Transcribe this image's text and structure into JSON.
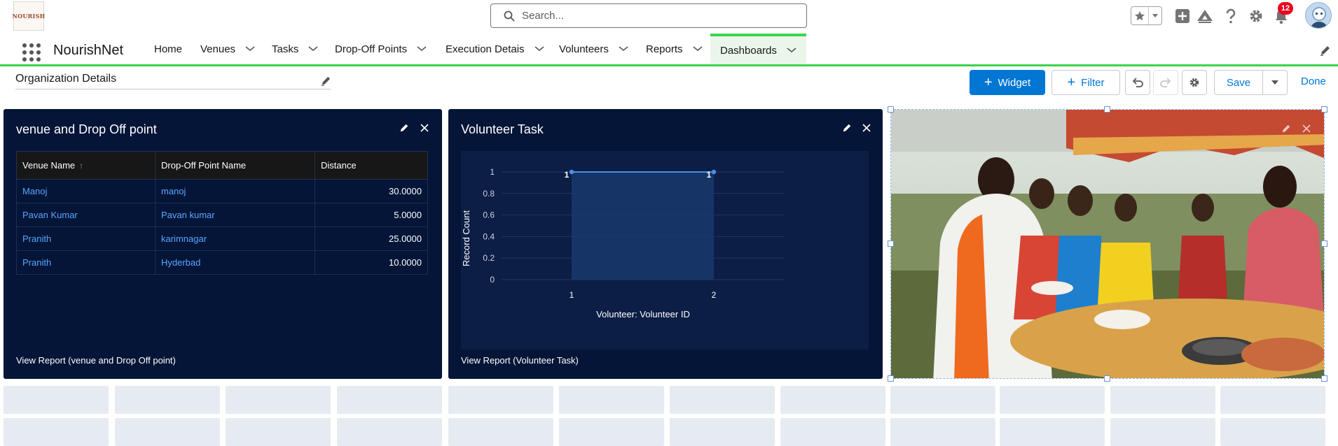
{
  "header": {
    "logo_text": "NOURISH",
    "search_placeholder": "Search...",
    "notification_count": "12",
    "icons": [
      "star-icon",
      "chevron-down-icon",
      "plus-icon",
      "trailhead-icon",
      "help-icon",
      "gear-icon",
      "bell-icon",
      "avatar-icon"
    ]
  },
  "nav": {
    "app_name": "NourishNet",
    "items": [
      {
        "label": "Home",
        "has_menu": false
      },
      {
        "label": "Venues",
        "has_menu": true
      },
      {
        "label": "Tasks",
        "has_menu": true
      },
      {
        "label": "Drop-Off Points",
        "has_menu": true
      },
      {
        "label": "Execution Detais",
        "has_menu": true
      },
      {
        "label": "Volunteers",
        "has_menu": true
      },
      {
        "label": "Reports",
        "has_menu": true
      },
      {
        "label": "Dashboards",
        "has_menu": true,
        "active": true
      }
    ]
  },
  "toolbar": {
    "dashboard_title": "Organization Details",
    "widget_label": "Widget",
    "filter_label": "Filter",
    "save_label": "Save",
    "done_label": "Done"
  },
  "widgets": {
    "table": {
      "title": "venue and Drop Off point",
      "columns": [
        "Venue Name",
        "Drop-Off Point Name",
        "Distance"
      ],
      "sort_indicator": "↑",
      "rows": [
        [
          "Manoj",
          "manoj",
          "30.0000"
        ],
        [
          "Pavan Kumar",
          "Pavan kumar",
          "5.0000"
        ],
        [
          "Pranith",
          "karimnagar",
          "25.0000"
        ],
        [
          "Pranith",
          "Hyderbad",
          "10.0000"
        ]
      ],
      "footer": "View Report (venue and Drop Off point)"
    },
    "chart": {
      "title": "Volunteer Task",
      "footer": "View Report (Volunteer Task)"
    }
  },
  "chart_data": {
    "type": "line",
    "title": "Volunteer Task",
    "xlabel": "Volunteer: Volunteer ID",
    "ylabel": "Record Count",
    "categories": [
      "1",
      "2"
    ],
    "series": [
      {
        "values": [
          1,
          1
        ]
      }
    ],
    "data_labels": [
      "1",
      "1"
    ],
    "y_ticks": [
      "0",
      "0.2",
      "0.4",
      "0.6",
      "0.8",
      "1"
    ],
    "ylim": [
      0,
      1
    ],
    "grid": true,
    "legend": "none",
    "line_color": "#4a90e2"
  },
  "colors": {
    "brand": "#0176d3",
    "nav_accent": "#3bd44c",
    "widget_bg": "#041537",
    "link": "#5aa6ff",
    "badge": "#ea001e"
  }
}
